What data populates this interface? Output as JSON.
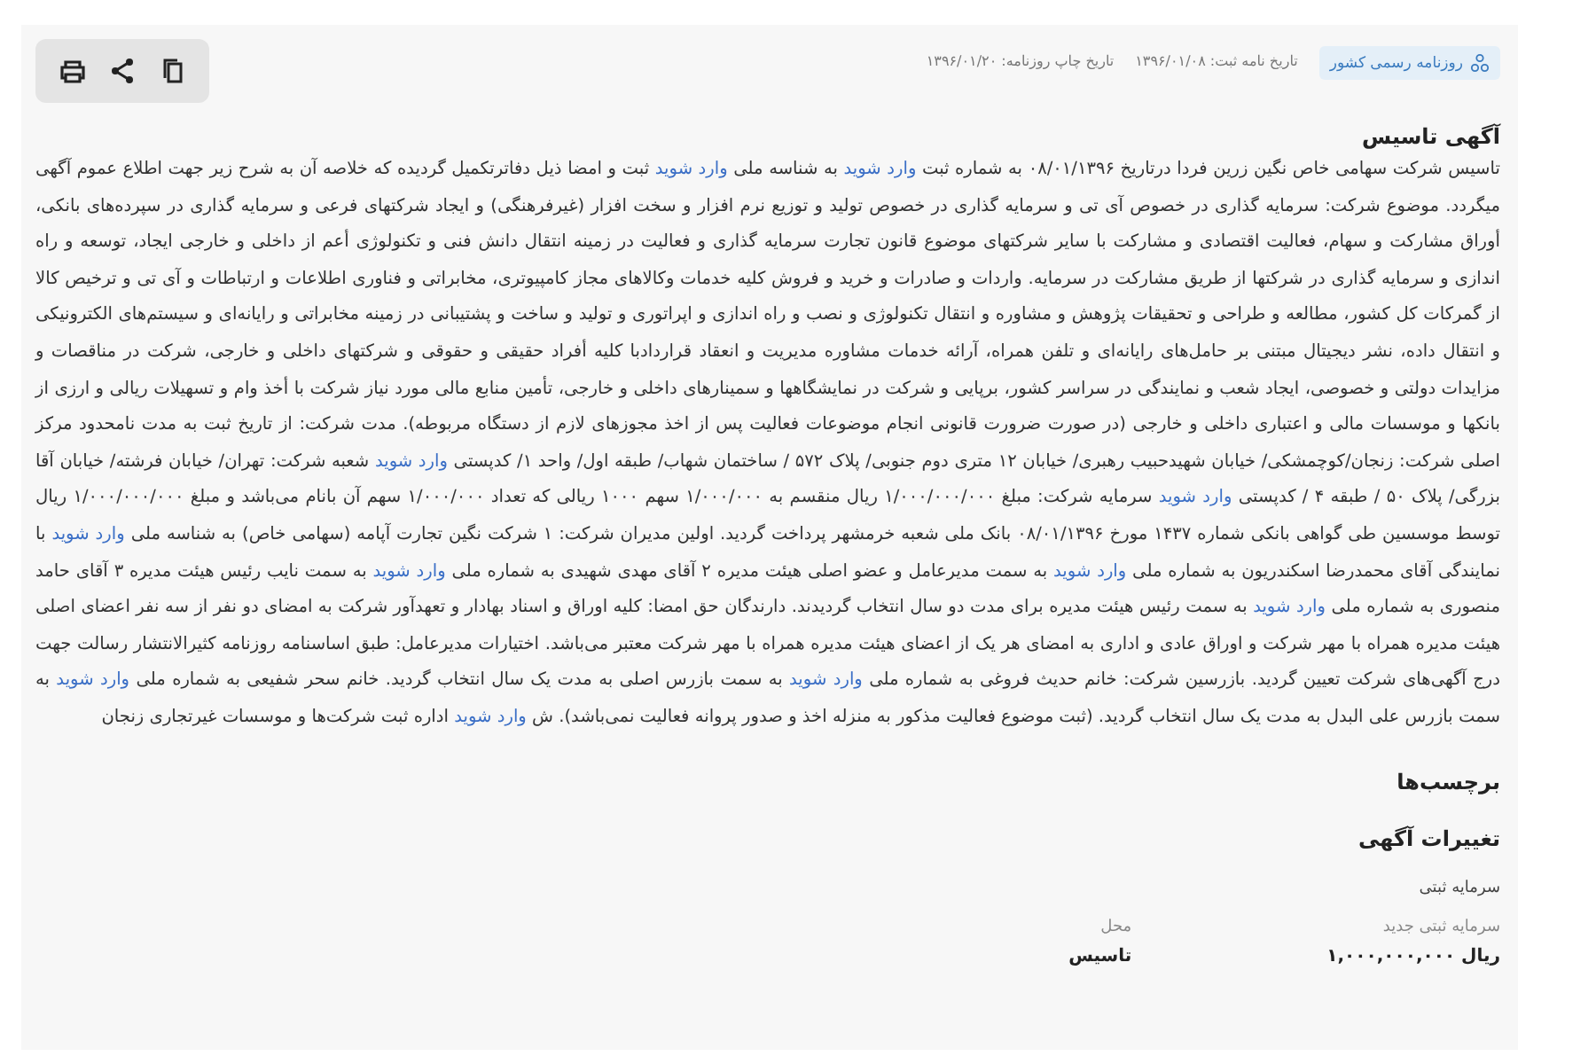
{
  "toolbar": {
    "buttons": [
      {
        "kind": "print"
      },
      {
        "kind": "share"
      },
      {
        "kind": "copy"
      }
    ]
  },
  "header": {
    "source": "روزنامه رسمی کشور",
    "meta": [
      "تاریخ نامه ثبت: ۱۳۹۶/۰۱/۰۸",
      "تاریخ چاپ روزنامه: ۱۳۹۶/۰۱/۲۰"
    ]
  },
  "notice": {
    "title": "آگهی تاسیس",
    "paragraph": [
      {
        "kind": "text",
        "text": "تاسیس شرکت سهامی خاص نگین زرین فردا درتاریخ ۰۸/۰۱/۱۳۹۶ به شماره ثبت "
      },
      {
        "kind": "link",
        "text": "وارد شوید"
      },
      {
        "kind": "text",
        "text": " به شناسه ملی "
      },
      {
        "kind": "link",
        "text": "وارد شوید"
      },
      {
        "kind": "text",
        "text": " ثبت و امضا ذیل دفاترتکمیل گردیده که خلاصه آن به شرح زیر جهت اطلاع عموم آگهی میگردد. موضوع شرکت: سرمایه گذاری در خصوص آی تی و سرمایه گذاری در خصوص تولید و توزیع نرم افزار و سخت افزار (غیرفرهنگی) و ایجاد شرکتهای فرعی و سرمایه گذاری در سپرده‌های بانکی، أوراق مشارکت و سهام، فعالیت اقتصادی و مشارکت با سایر شرکتهای موضوع قانون تجارت سرمایه گذاری و فعالیت در زمینه انتقال دانش فنی و تکنولوژی أعم از داخلی و خارجی ایجاد، توسعه و راه اندازی و سرمایه گذاری در شرکتها از طریق مشارکت در سرمایه. واردات و صادرات و خرید و فروش کلیه خدمات وکالاهای مجاز کامپیوتری، مخابراتی و فناوری اطلاعات و ارتباطات و آی تی و ترخیص کالا از گمرکات کل کشور، مطالعه و طراحی و تحقیقات پژوهش و مشاوره و انتقال تکنولوژی و نصب و راه اندازی و اپراتوری و تولید و ساخت و پشتیبانی در زمینه مخابراتی و رایانه‌ای و سیستم‌های الکترونیکی و انتقال داده، نشر دیجیتال مبتنی بر حامل‌های رایانه‌ای و تلفن همراه، آرائه خدمات مشاوره مدیریت و انعقاد قراردادبا کلیه أفراد حقیقی و حقوقی و شرکتهای داخلی و خارجی، شرکت در مناقصات و مزایدات دولتی و خصوصی، ایجاد شعب و نمایندگی در سراسر کشور، برپایی و شرکت در نمایشگاهها و سمینارهای داخلی و خارجی، تأمین منابع مالی مورد نیاز شرکت با أخذ وام و تسهیلات ریالی و ارزی از بانکها و موسسات مالی و اعتباری داخلی و خارجی (در صورت ضرورت قانونی انجام موضوعات فعالیت پس از اخذ مجوزهای لازم از دستگاه مربوطه). مدت شرکت: از تاریخ ثبت به مدت نامحدود مرکز اصلی شرکت: زنجان/کوچمشکی/ خیابان شهیدحبیب رهبری/ خیابان ۱۲ متری دوم جنوبی/ پلاک ۵۷۲ / ساختمان شهاب/ طبقه اول/ واحد ۱/ کدپستی "
      },
      {
        "kind": "link",
        "text": "وارد شوید"
      },
      {
        "kind": "text",
        "text": " شعبه شرکت: تهران/ خیابان فرشته/ خیابان آقا بزرگی/ پلاک ۵۰ / طبقه ۴ / کدپستی "
      },
      {
        "kind": "link",
        "text": "وارد شوید"
      },
      {
        "kind": "text",
        "text": " سرمایه شرکت: مبلغ ۱/۰۰۰/۰۰۰/۰۰۰ ریال منقسم به ۱/۰۰۰/۰۰۰ سهم ۱۰۰۰ ریالی که تعداد ۱/۰۰۰/۰۰۰ سهم آن بانام می‌باشد و مبلغ ۱/۰۰۰/۰۰۰/۰۰۰ ریال توسط موسسین طی گواهی بانکی شماره ۱۴۳۷ مورخ ۰۸/۰۱/۱۳۹۶ بانک ملی شعبه خرمشهر پرداخت گردید. اولین مدیران شرکت: ۱ شرکت نگین تجارت آپامه (سهامی خاص) به شناسه ملی "
      },
      {
        "kind": "link",
        "text": "وارد شوید"
      },
      {
        "kind": "text",
        "text": " با نمایندگی آقای محمدرضا اسکندریون به شماره ملی "
      },
      {
        "kind": "link",
        "text": "وارد شوید"
      },
      {
        "kind": "text",
        "text": " به سمت مدیرعامل و عضو اصلی هیئت مدیره ۲ آقای مهدی شهیدی به شماره ملی "
      },
      {
        "kind": "link",
        "text": "وارد شوید"
      },
      {
        "kind": "text",
        "text": " به سمت نایب رئیس هیئت مدیره ۳ آقای حامد منصوری به شماره ملی "
      },
      {
        "kind": "link",
        "text": "وارد شوید"
      },
      {
        "kind": "text",
        "text": " به سمت رئیس هیئت مدیره برای مدت دو سال انتخاب گردیدند. دارندگان حق امضا: کلیه اوراق و اسناد بهادار و تعهدآور شرکت به امضای دو نفر از سه نفر اعضای اصلی هیئت مدیره همراه با مهر شرکت و اوراق عادی و اداری به امضای هر یک از اعضای هیئت مدیره همراه با مهر شرکت معتبر می‌باشد. اختیارات مدیرعامل: طبق اساسنامه روزنامه کثیرالانتشار رسالت جهت درج آگهی‌های شرکت تعیین گردید. بازرسین شرکت: خانم حدیث فروغی به شماره ملی "
      },
      {
        "kind": "link",
        "text": "وارد شوید"
      },
      {
        "kind": "text",
        "text": " به سمت بازرس اصلی به مدت یک سال انتخاب گردید. خانم سحر شفیعی به شماره ملی "
      },
      {
        "kind": "link",
        "text": "وارد شوید"
      },
      {
        "kind": "text",
        "text": " به سمت بازرس علی البدل به مدت یک سال انتخاب گردید. (ثبت موضوع فعالیت مذکور به منزله اخذ و صدور پروانه فعالیت نمی‌باشد). ش "
      },
      {
        "kind": "link",
        "text": "وارد شوید"
      },
      {
        "kind": "text",
        "text": " اداره ثبت شرکت‌ها و موسسات غیرتجاری زنجان"
      }
    ]
  },
  "tags": {
    "title": "برچسب‌ها"
  },
  "changes": {
    "title": "تغییرات آگهی",
    "group": "سرمایه ثبتی",
    "fields": [
      {
        "label": "سرمایه ثبتی جدید",
        "value": "۱,۰۰۰,۰۰۰,۰۰۰ ریال"
      },
      {
        "label": "محل",
        "value": "تاسیس"
      }
    ]
  }
}
